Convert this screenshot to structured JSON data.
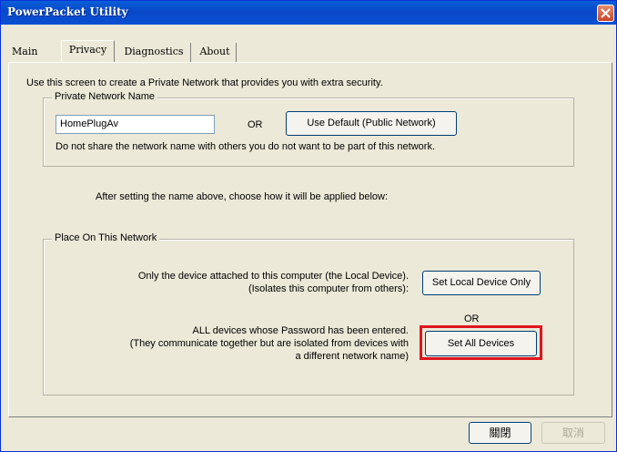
{
  "window": {
    "title": "PowerPacket Utility"
  },
  "tabs": [
    {
      "label": "Main"
    },
    {
      "label": "Privacy"
    },
    {
      "label": "Diagnostics"
    },
    {
      "label": "About"
    }
  ],
  "privacy": {
    "intro": "Use this screen to create a Private Network that provides you with extra security.",
    "network_name_group": {
      "legend": "Private Network Name",
      "name_value": "HomePlugAv",
      "or_label": "OR",
      "use_default_button": "Use Default (Public Network)",
      "note": "Do not share the network name with others you do not want to be part of this network."
    },
    "after_text": "After setting the name above, choose how it will be applied below:",
    "place_group": {
      "legend": "Place On This Network",
      "local_line1": "Only the device attached to this computer (the Local Device).",
      "local_line2": "(Isolates this computer from others):",
      "set_local_button": "Set Local Device Only",
      "or_label": "OR",
      "all_line1": "ALL devices whose Password has been entered.",
      "all_line2": "(They communicate together but are isolated from devices with",
      "all_line3": "a different network name)",
      "set_all_button": "Set All Devices"
    }
  },
  "footer": {
    "close_button": "關閉",
    "cancel_button": "取消"
  },
  "colors": {
    "titlebar": "#0a54d6",
    "highlight": "#e0151e",
    "dialog_bg": "#ece9d8"
  }
}
